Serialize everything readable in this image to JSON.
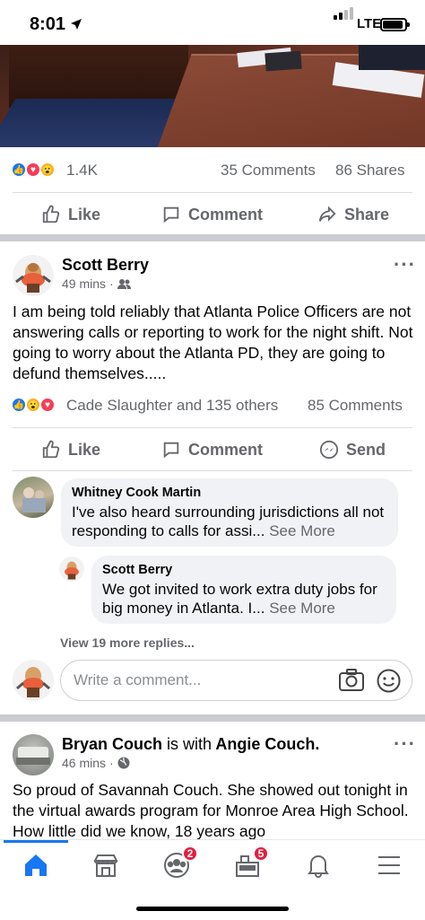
{
  "status_bar": {
    "time": "8:01",
    "network": "LTE"
  },
  "top_post": {
    "reaction_count": "1.4K",
    "comments": "35 Comments",
    "shares": "86 Shares",
    "actions": {
      "like": "Like",
      "comment": "Comment",
      "share": "Share"
    }
  },
  "post": {
    "author": "Scott Berry",
    "time": "49 mins",
    "text": "I am being told reliably that Atlanta Police Officers are not answering calls or reporting to work for the night shift.   Not going to worry about the Atlanta PD, they are going to defund themselves.....",
    "reactors": "Cade Slaughter and 135 others",
    "comments": "85 Comments",
    "actions": {
      "like": "Like",
      "comment": "Comment",
      "send": "Send"
    },
    "comment_list": [
      {
        "name": "Whitney Cook Martin",
        "text": "I've also heard surrounding jurisdictions all not responding to calls for assi...",
        "see_more": "See More"
      },
      {
        "name": "Scott Berry",
        "text": "We got invited to work extra duty jobs for big money in Atlanta.  I...",
        "see_more": "See More"
      }
    ],
    "view_more": "View 19 more replies...",
    "write_placeholder": "Write a comment..."
  },
  "next_post": {
    "author": "Bryan Couch",
    "with_text": "is with",
    "tagged": "Angie Couch.",
    "time": "46 mins",
    "text": "So proud of Savannah Couch. She showed out tonight in the virtual awards program for Monroe Area High School. How little did we know, 18 years ago"
  },
  "tabbar": {
    "groups_badge": "2",
    "pages_badge": "5"
  },
  "colors": {
    "accent": "#1877f2",
    "badge": "#e41e3f",
    "muted": "#65676b"
  },
  "icons": [
    "home-icon",
    "marketplace-icon",
    "groups-icon",
    "pages-icon",
    "bell-icon",
    "menu-icon"
  ]
}
